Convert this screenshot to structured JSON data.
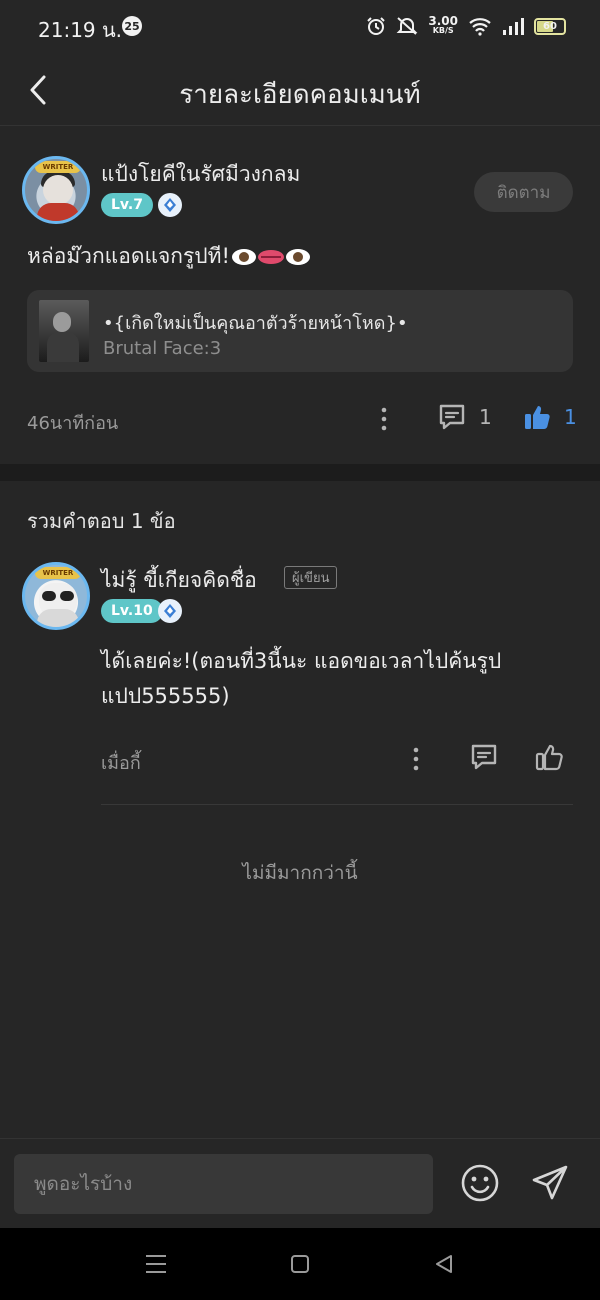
{
  "status_bar": {
    "time": "21:19 น.",
    "notification_count": "25",
    "net_speed_value": "3.00",
    "net_speed_unit": "KB/S",
    "battery": "60",
    "icons": [
      "alarm-icon",
      "mute-icon",
      "wifi-icon",
      "signal-icon",
      "battery-icon"
    ]
  },
  "header": {
    "title": "รายละเอียดคอมเมนท์",
    "back_icon": "chevron-left-icon"
  },
  "comment": {
    "username": "แป้งโยคีในรัศมีวงกลม",
    "level": "Lv.7",
    "follow_label": "ติดตาม",
    "text": "หล่อม๊วกแอดแจกรูปที!",
    "emojis": [
      "eye",
      "lips",
      "eye"
    ],
    "story": {
      "title": "•{เกิดใหม่เป็นคุณอาตัวร้ายหน้าโหด}•",
      "subtitle": "Brutal Face:3"
    },
    "time": "46นาทีก่อน",
    "reply_count": "1",
    "like_count": "1"
  },
  "replies": {
    "header": "รวมคำตอบ 1 ข้อ",
    "items": [
      {
        "username": "ไม่รู้ ขี้เกียจคิดชื่อ",
        "author_tag": "ผู้เขียน",
        "level": "Lv.10",
        "text": "ได้เลยค่ะ!(ตอนที่3นี้นะ แอดขอเวลาไปค้นรูปแปป555555)",
        "time": "เมื่อกี้"
      }
    ],
    "no_more": "ไม่มีมากกว่านี้"
  },
  "input": {
    "placeholder": "พูดอะไรบ้าง"
  },
  "colors": {
    "background": "#262626",
    "level_badge": "#5fc6c8",
    "like_active": "#4a90e2",
    "avatar_ring": "#6bb8f0"
  }
}
